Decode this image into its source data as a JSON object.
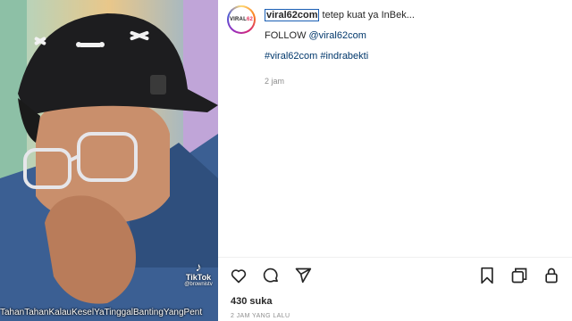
{
  "post": {
    "username": "viral62com",
    "caption_first_line": "tetep kuat ya InBek...",
    "follow_prefix": "FOLLOW ",
    "follow_handle": "@viral62com",
    "hashtags": "#viral62com #indrabekti",
    "time_short": "2 jam",
    "likes": "430 suka",
    "time_long": "2 JAM YANG LALU"
  },
  "avatar": {
    "text_main": "VIRAL",
    "text_accent": "62"
  },
  "media": {
    "tiktok_label": "TikTok",
    "tiktok_handle": "@brownistv",
    "caption_strip": "TahanTahanKalauKeselYaTinggalBantingYangPent"
  },
  "icons": [
    "heart-icon",
    "comment-icon",
    "share-icon",
    "bookmark-icon",
    "copy-icon",
    "lock-icon"
  ],
  "colors": {
    "link": "#00376b",
    "muted": "#8e8e8e",
    "text": "#262626"
  }
}
